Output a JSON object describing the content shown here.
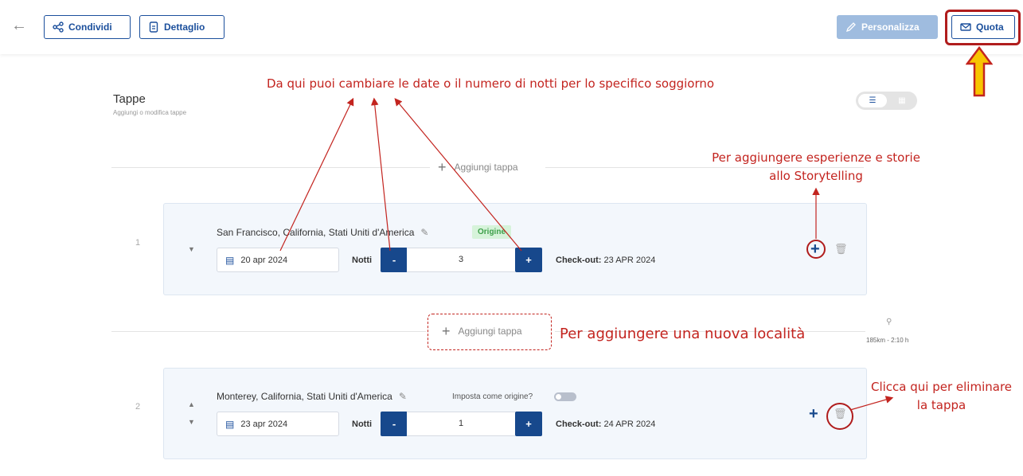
{
  "toolbar": {
    "share_label": "Condividi",
    "detail_label": "Dettaglio",
    "personalize_label": "Personalizza",
    "quote_label": "Quota"
  },
  "section": {
    "title": "Tappe",
    "subtitle": "Aggiungi o modifica tappe",
    "add_stop_label": "Aggiungi tappa"
  },
  "stops": [
    {
      "number": "1",
      "name": "San Francisco, California, Stati Uniti d'America",
      "origin_badge": "Origine",
      "date": "20 apr 2024",
      "nights_label": "Notti",
      "nights": "3",
      "checkout_label": "Check-out:",
      "checkout_date": "23 APR 2024"
    },
    {
      "number": "2",
      "name": "Monterey, California, Stati Uniti d'America",
      "origin_question": "Imposta come origine?",
      "date": "23 apr 2024",
      "nights_label": "Notti",
      "nights": "1",
      "checkout_label": "Check-out:",
      "checkout_date": "24 APR 2024"
    }
  ],
  "distance": "185km - 2:10 h",
  "annotations": {
    "dates_hint": "Da qui puoi cambiare le date o il numero di notti per lo specifico soggiorno",
    "storytelling_hint": [
      "Per aggiungere esperienze e storie",
      "allo Storytelling"
    ],
    "new_location_hint": "Per aggiungere una nuova località",
    "delete_hint": [
      "Clicca qui per eliminare",
      "la tappa"
    ]
  },
  "colors": {
    "primary": "#17488c",
    "personalize_bg": "#9fbcdf",
    "annotation": "#c3241f",
    "badge_green": "#3da04a",
    "card_bg": "#f3f7fc"
  },
  "icons": {
    "back": "arrow-left-icon",
    "share": "share-icon",
    "detail": "document-icon",
    "personalize": "pencil-icon",
    "quote": "envelope-icon",
    "calendar": "calendar-icon",
    "trash": "trash-icon",
    "add": "plus-icon",
    "pin": "map-pin-icon"
  }
}
